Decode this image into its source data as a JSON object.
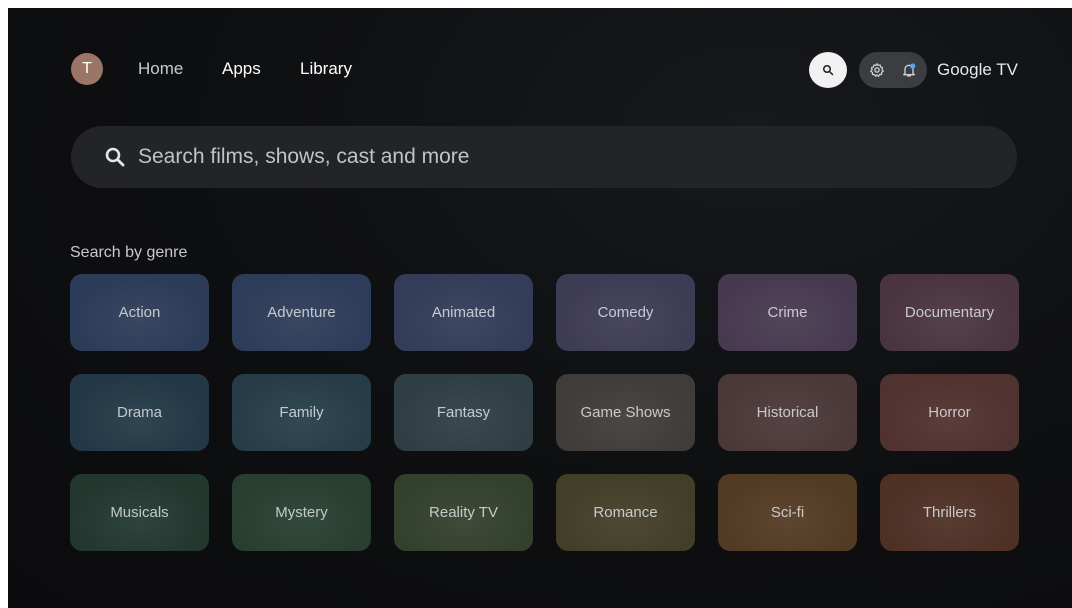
{
  "user": {
    "initial": "T"
  },
  "nav": {
    "items": [
      {
        "label": "Home"
      },
      {
        "label": "Apps"
      },
      {
        "label": "Library"
      }
    ]
  },
  "header": {
    "brand": "Google TV",
    "icons": [
      "search-icon",
      "gear-icon",
      "notification-bell-icon"
    ]
  },
  "search": {
    "placeholder": "Search films, shows, cast and more"
  },
  "genre_section": {
    "title": "Search by genre",
    "genres": [
      {
        "label": "Action",
        "color": "#2c3b57"
      },
      {
        "label": "Adventure",
        "color": "#2d3c58"
      },
      {
        "label": "Animated",
        "color": "#333c58"
      },
      {
        "label": "Comedy",
        "color": "#3e3b55"
      },
      {
        "label": "Crime",
        "color": "#473a50"
      },
      {
        "label": "Documentary",
        "color": "#4a3440"
      },
      {
        "label": "Drama",
        "color": "#233846"
      },
      {
        "label": "Family",
        "color": "#263d48"
      },
      {
        "label": "Fantasy",
        "color": "#2f3e44"
      },
      {
        "label": "Game Shows",
        "color": "#3f3c3a"
      },
      {
        "label": "Historical",
        "color": "#4b3838"
      },
      {
        "label": "Horror",
        "color": "#503230"
      },
      {
        "label": "Musicals",
        "color": "#22382f"
      },
      {
        "label": "Mystery",
        "color": "#273e30"
      },
      {
        "label": "Reality TV",
        "color": "#33402c"
      },
      {
        "label": "Romance",
        "color": "#433e28"
      },
      {
        "label": "Sci-fi",
        "color": "#533a24"
      },
      {
        "label": "Thrillers",
        "color": "#4e3025"
      }
    ]
  }
}
